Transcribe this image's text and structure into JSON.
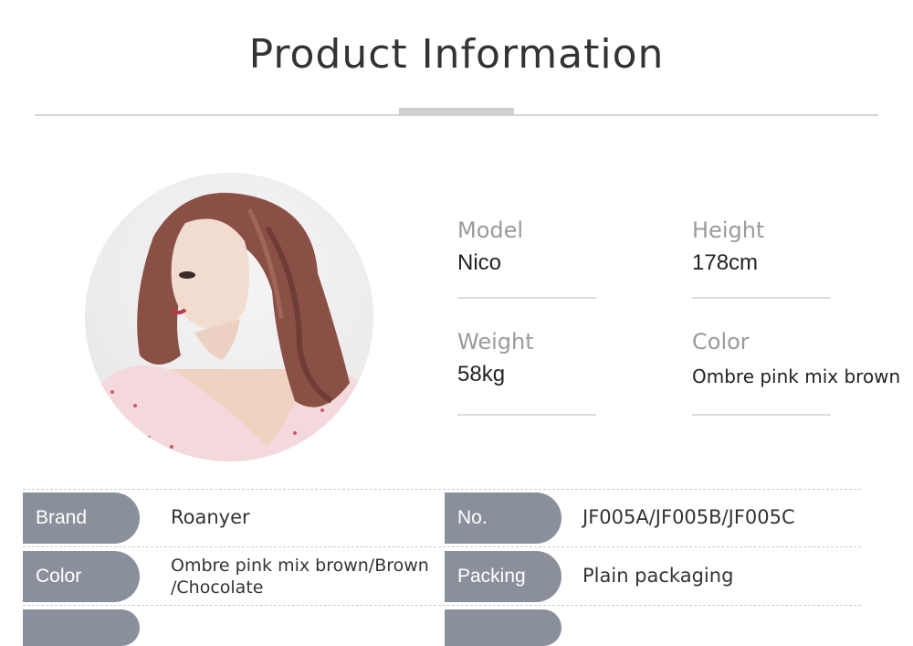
{
  "title": "Product Information",
  "specs": {
    "model_label": "Model",
    "model_value": "Nico",
    "height_label": "Height",
    "height_value": "178cm",
    "weight_label": "Weight",
    "weight_value": "58kg",
    "color_label": "Color",
    "color_value": "Ombre pink mix brown"
  },
  "table": {
    "row1": {
      "tag1": "Brand",
      "val1": "Roanyer",
      "tag2": "No.",
      "val2": "JF005A/JF005B/JF005C"
    },
    "row2": {
      "tag1": "Color",
      "val1_line1": "Ombre pink mix brown/Brown",
      "val1_line2": "/Chocolate",
      "tag2": "Packing",
      "val2": "Plain packaging"
    }
  },
  "colors": {
    "tag_background": "#8a909b",
    "rule": "#d4d4d4",
    "label_gray": "#9a9a9a"
  }
}
